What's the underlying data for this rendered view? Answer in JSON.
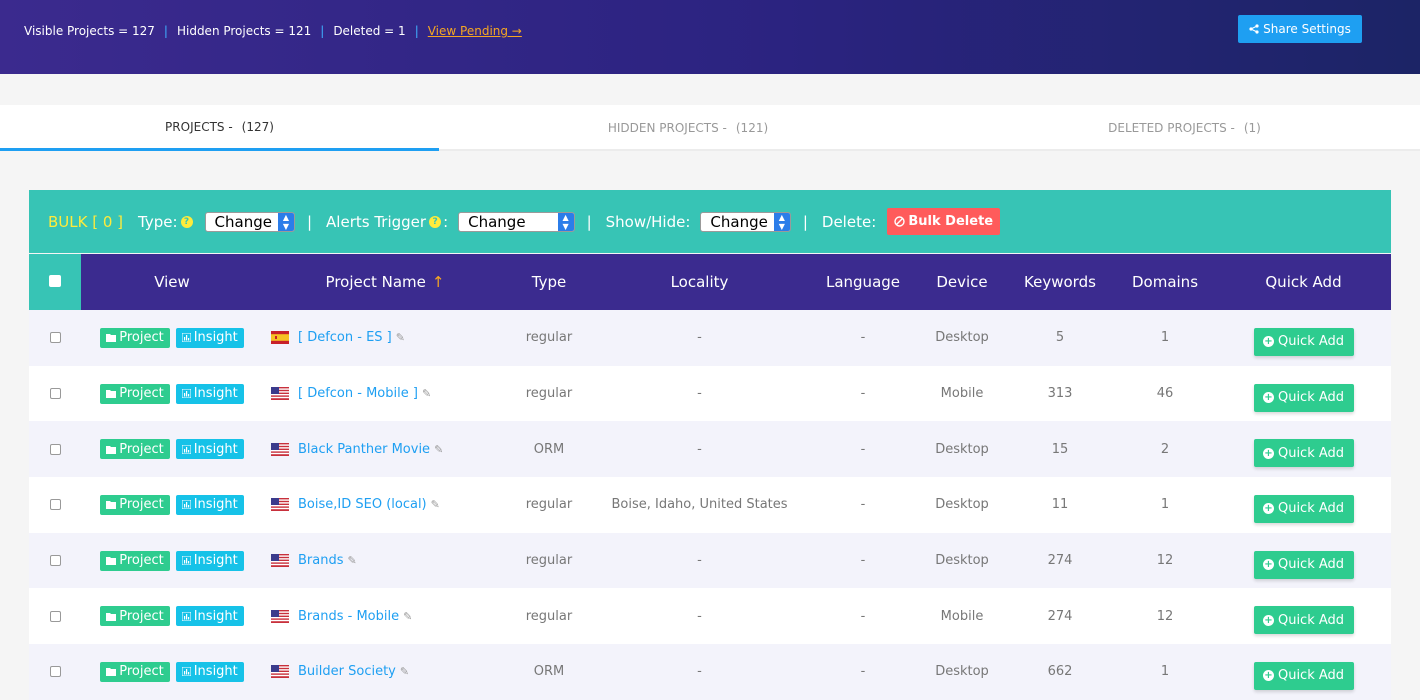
{
  "header": {
    "visible_projects": "Visible Projects = 127",
    "hidden_projects": "Hidden Projects = 121",
    "deleted": "Deleted = 1",
    "view_pending": "View Pending →",
    "share_settings": "Share Settings"
  },
  "tabs": [
    {
      "label": "PROJECTS -",
      "count": "(127)"
    },
    {
      "label": "HIDDEN PROJECTS -",
      "count": "(121)"
    },
    {
      "label": "DELETED PROJECTS -",
      "count": "(1)"
    }
  ],
  "bulkbar": {
    "bulk_label": "BULK [ 0 ]",
    "type_label": "Type:",
    "type_value": "Change",
    "alerts_label": "Alerts Trigger",
    "alerts_value": "Change",
    "showhide_label": "Show/Hide:",
    "showhide_value": "Change",
    "delete_label": "Delete:",
    "bulk_delete": "Bulk Delete"
  },
  "table": {
    "headers": {
      "view": "View",
      "project_name": "Project Name",
      "type": "Type",
      "locality": "Locality",
      "language": "Language",
      "device": "Device",
      "keywords": "Keywords",
      "domains": "Domains",
      "quick_add": "Quick Add"
    },
    "project_btn": "Project",
    "insight_btn": "Insight",
    "quick_add_btn": "Quick Add",
    "rows": [
      {
        "flag": "es",
        "name": "[ Defcon - ES ]",
        "type": "regular",
        "locality": "-",
        "language": "-",
        "device": "Desktop",
        "keywords": "5",
        "domains": "1"
      },
      {
        "flag": "us",
        "name": "[ Defcon - Mobile ]",
        "type": "regular",
        "locality": "-",
        "language": "-",
        "device": "Mobile",
        "keywords": "313",
        "domains": "46"
      },
      {
        "flag": "us",
        "name": "Black Panther Movie",
        "type": "ORM",
        "locality": "-",
        "language": "-",
        "device": "Desktop",
        "keywords": "15",
        "domains": "2"
      },
      {
        "flag": "us",
        "name": "Boise,ID SEO (local)",
        "type": "regular",
        "locality": "Boise, Idaho, United States",
        "language": "-",
        "device": "Desktop",
        "keywords": "11",
        "domains": "1"
      },
      {
        "flag": "us",
        "name": "Brands",
        "type": "regular",
        "locality": "-",
        "language": "-",
        "device": "Desktop",
        "keywords": "274",
        "domains": "12"
      },
      {
        "flag": "us",
        "name": "Brands - Mobile",
        "type": "regular",
        "locality": "-",
        "language": "-",
        "device": "Mobile",
        "keywords": "274",
        "domains": "12"
      },
      {
        "flag": "us",
        "name": "Builder Society",
        "type": "ORM",
        "locality": "-",
        "language": "-",
        "device": "Desktop",
        "keywords": "662",
        "domains": "1"
      }
    ]
  }
}
